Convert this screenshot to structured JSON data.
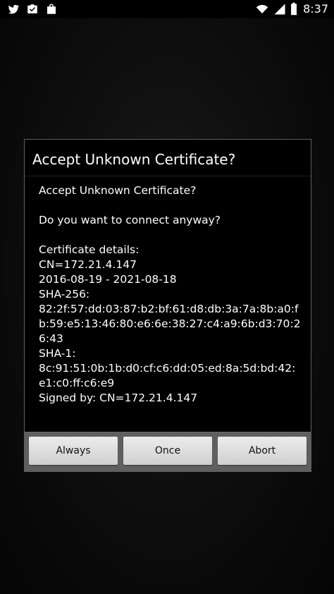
{
  "statusbar": {
    "time": "8:37",
    "left_icons": [
      "twitter-icon",
      "briefcase-check-icon",
      "shopping-bag-icon"
    ],
    "right_icons": [
      "wifi-icon",
      "signal-icon",
      "battery-icon"
    ]
  },
  "dialog": {
    "title": "Accept Unknown Certificate?",
    "message_heading": "Accept Unknown Certificate?",
    "question": "Do you want to connect anyway?",
    "details_label": "Certificate details:",
    "cn": "CN=172.21.4.147",
    "validity": "2016-08-19 - 2021-08-18",
    "sha256_label": "SHA-256:",
    "sha256": "82:2f:57:dd:03:87:b2:bf:61:d8:db:3a:7a:8b:a0:fb:59:e5:13:46:80:e6:6e:38:27:c4:a9:6b:d3:70:26:43",
    "sha1_label": "SHA-1:",
    "sha1": "8c:91:51:0b:1b:d0:cf:c6:dd:05:ed:8a:5d:bd:42:e1:c0:ff:c6:e9",
    "signed_by": "Signed by: CN=172.21.4.147",
    "buttons": {
      "always": "Always",
      "once": "Once",
      "abort": "Abort"
    }
  },
  "colors": {
    "dialog_bg": "#000000",
    "button_bar": "#5f5f5f",
    "button_face": "#e0e0e0"
  }
}
